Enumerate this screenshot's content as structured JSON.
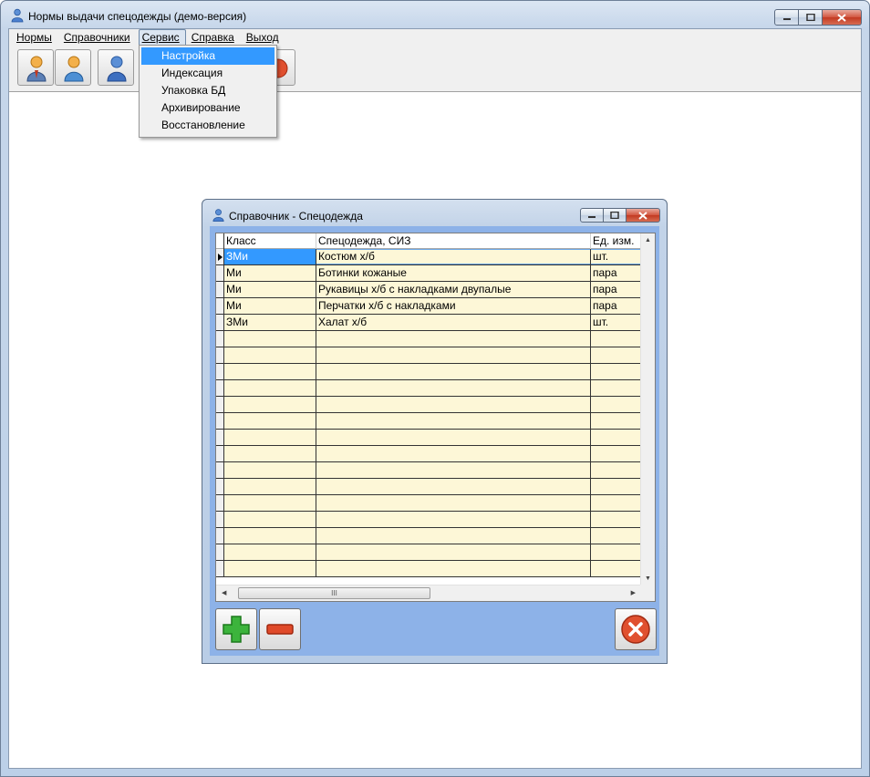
{
  "window": {
    "title": "Нормы выдачи спецодежды (демо-версия)",
    "minimize_icon": "minimize-icon",
    "maximize_icon": "maximize-icon",
    "close_icon": "close-icon"
  },
  "menu": {
    "items": [
      {
        "label": "Нормы"
      },
      {
        "label": "Справочники"
      },
      {
        "label": "Сервис"
      },
      {
        "label": "Справка"
      },
      {
        "label": "Выход"
      }
    ],
    "open_index": 2
  },
  "toolbar": {
    "buttons": [
      "person-icon",
      "person-icon",
      "person-icon",
      "exit-icon"
    ]
  },
  "dropdown": {
    "items": [
      {
        "label": "Настройка",
        "highlighted": true
      },
      {
        "label": "Индексация"
      },
      {
        "label": "Упаковка БД"
      },
      {
        "label": "Архивирование"
      },
      {
        "label": "Восстановление"
      }
    ]
  },
  "dialog": {
    "title": "Справочник - Спецодежда",
    "columns": [
      "Класс",
      "Спецодежда, СИЗ",
      "Ед. изм."
    ],
    "rows": [
      {
        "class": "ЗМи",
        "item": "Костюм х/б",
        "unit": "шт."
      },
      {
        "class": "Ми",
        "item": "Ботинки кожаные",
        "unit": "пара"
      },
      {
        "class": "Ми",
        "item": "Рукавицы х/б с накладками двупалые",
        "unit": "пара"
      },
      {
        "class": "Ми",
        "item": "Перчатки х/б с накладками",
        "unit": "пара"
      },
      {
        "class": "ЗМи",
        "item": "Халат х/б",
        "unit": "шт."
      }
    ],
    "selected_row": 0,
    "scroll_thumb_label": "III",
    "add_icon": "plus-icon",
    "remove_icon": "minus-icon",
    "close_icon": "close-circle-icon"
  },
  "colors": {
    "row_bg": "#fdf7d7",
    "selection": "#3399ff",
    "dialog_panel": "#8db2e8"
  }
}
